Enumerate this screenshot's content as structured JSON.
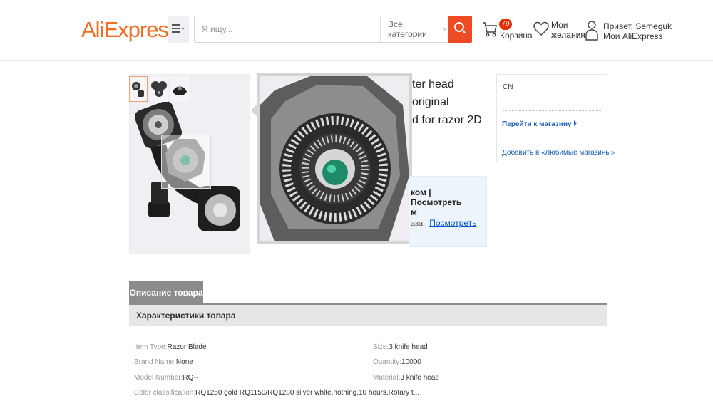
{
  "header": {
    "logo": "AliExpress",
    "logo_tm": "™",
    "search_placeholder": "Я ищу...",
    "category": "Все категории",
    "cart_count": "79",
    "cart_label": "Корзина",
    "wishlist_line1": "Мои",
    "wishlist_line2": "желания",
    "account_line1": "Привет, Semeguk",
    "account_line2": "Мои AliExpress"
  },
  "product": {
    "title_line1": "ter head original",
    "title_line2": "d for razor 2D",
    "info_line1": "ком |  Посмотреть",
    "info_line1b": "м",
    "info_line2": "аза.",
    "info_link": "Посмотреть"
  },
  "store": {
    "country": "CN",
    "go_to_store": "Перейти к магазину",
    "add_favorite": "Добавить в «Любимые магазины»"
  },
  "tabs": {
    "description": "Описание товара"
  },
  "specs": {
    "heading": "Характеристики товара",
    "items": [
      {
        "key": "Item Type:",
        "value": "Razor Blade"
      },
      {
        "key": "Size:",
        "value": "3 knife head"
      },
      {
        "key": "Brand Name:",
        "value": "None"
      },
      {
        "key": "Quantity:",
        "value": "10000"
      },
      {
        "key": "Model Number:",
        "value": "RQ--"
      },
      {
        "key": "Material:",
        "value": "3 knife head"
      },
      {
        "key": "Color classification:",
        "value": "RQ1250 gold RQ1150/RQ1280 silver white,nothing,10 hours,Rotary t..."
      }
    ]
  },
  "colors": {
    "brand_orange": "#f36c21",
    "search_button": "#ee4b25",
    "badge_red": "#e62e04",
    "link_blue": "#1a5fb4",
    "tab_gray": "#8c8c8c"
  },
  "icons": {
    "menu": "hamburger-menu-icon",
    "search": "search-icon",
    "cart": "cart-icon",
    "wishlist": "heart-icon",
    "account": "user-icon"
  }
}
